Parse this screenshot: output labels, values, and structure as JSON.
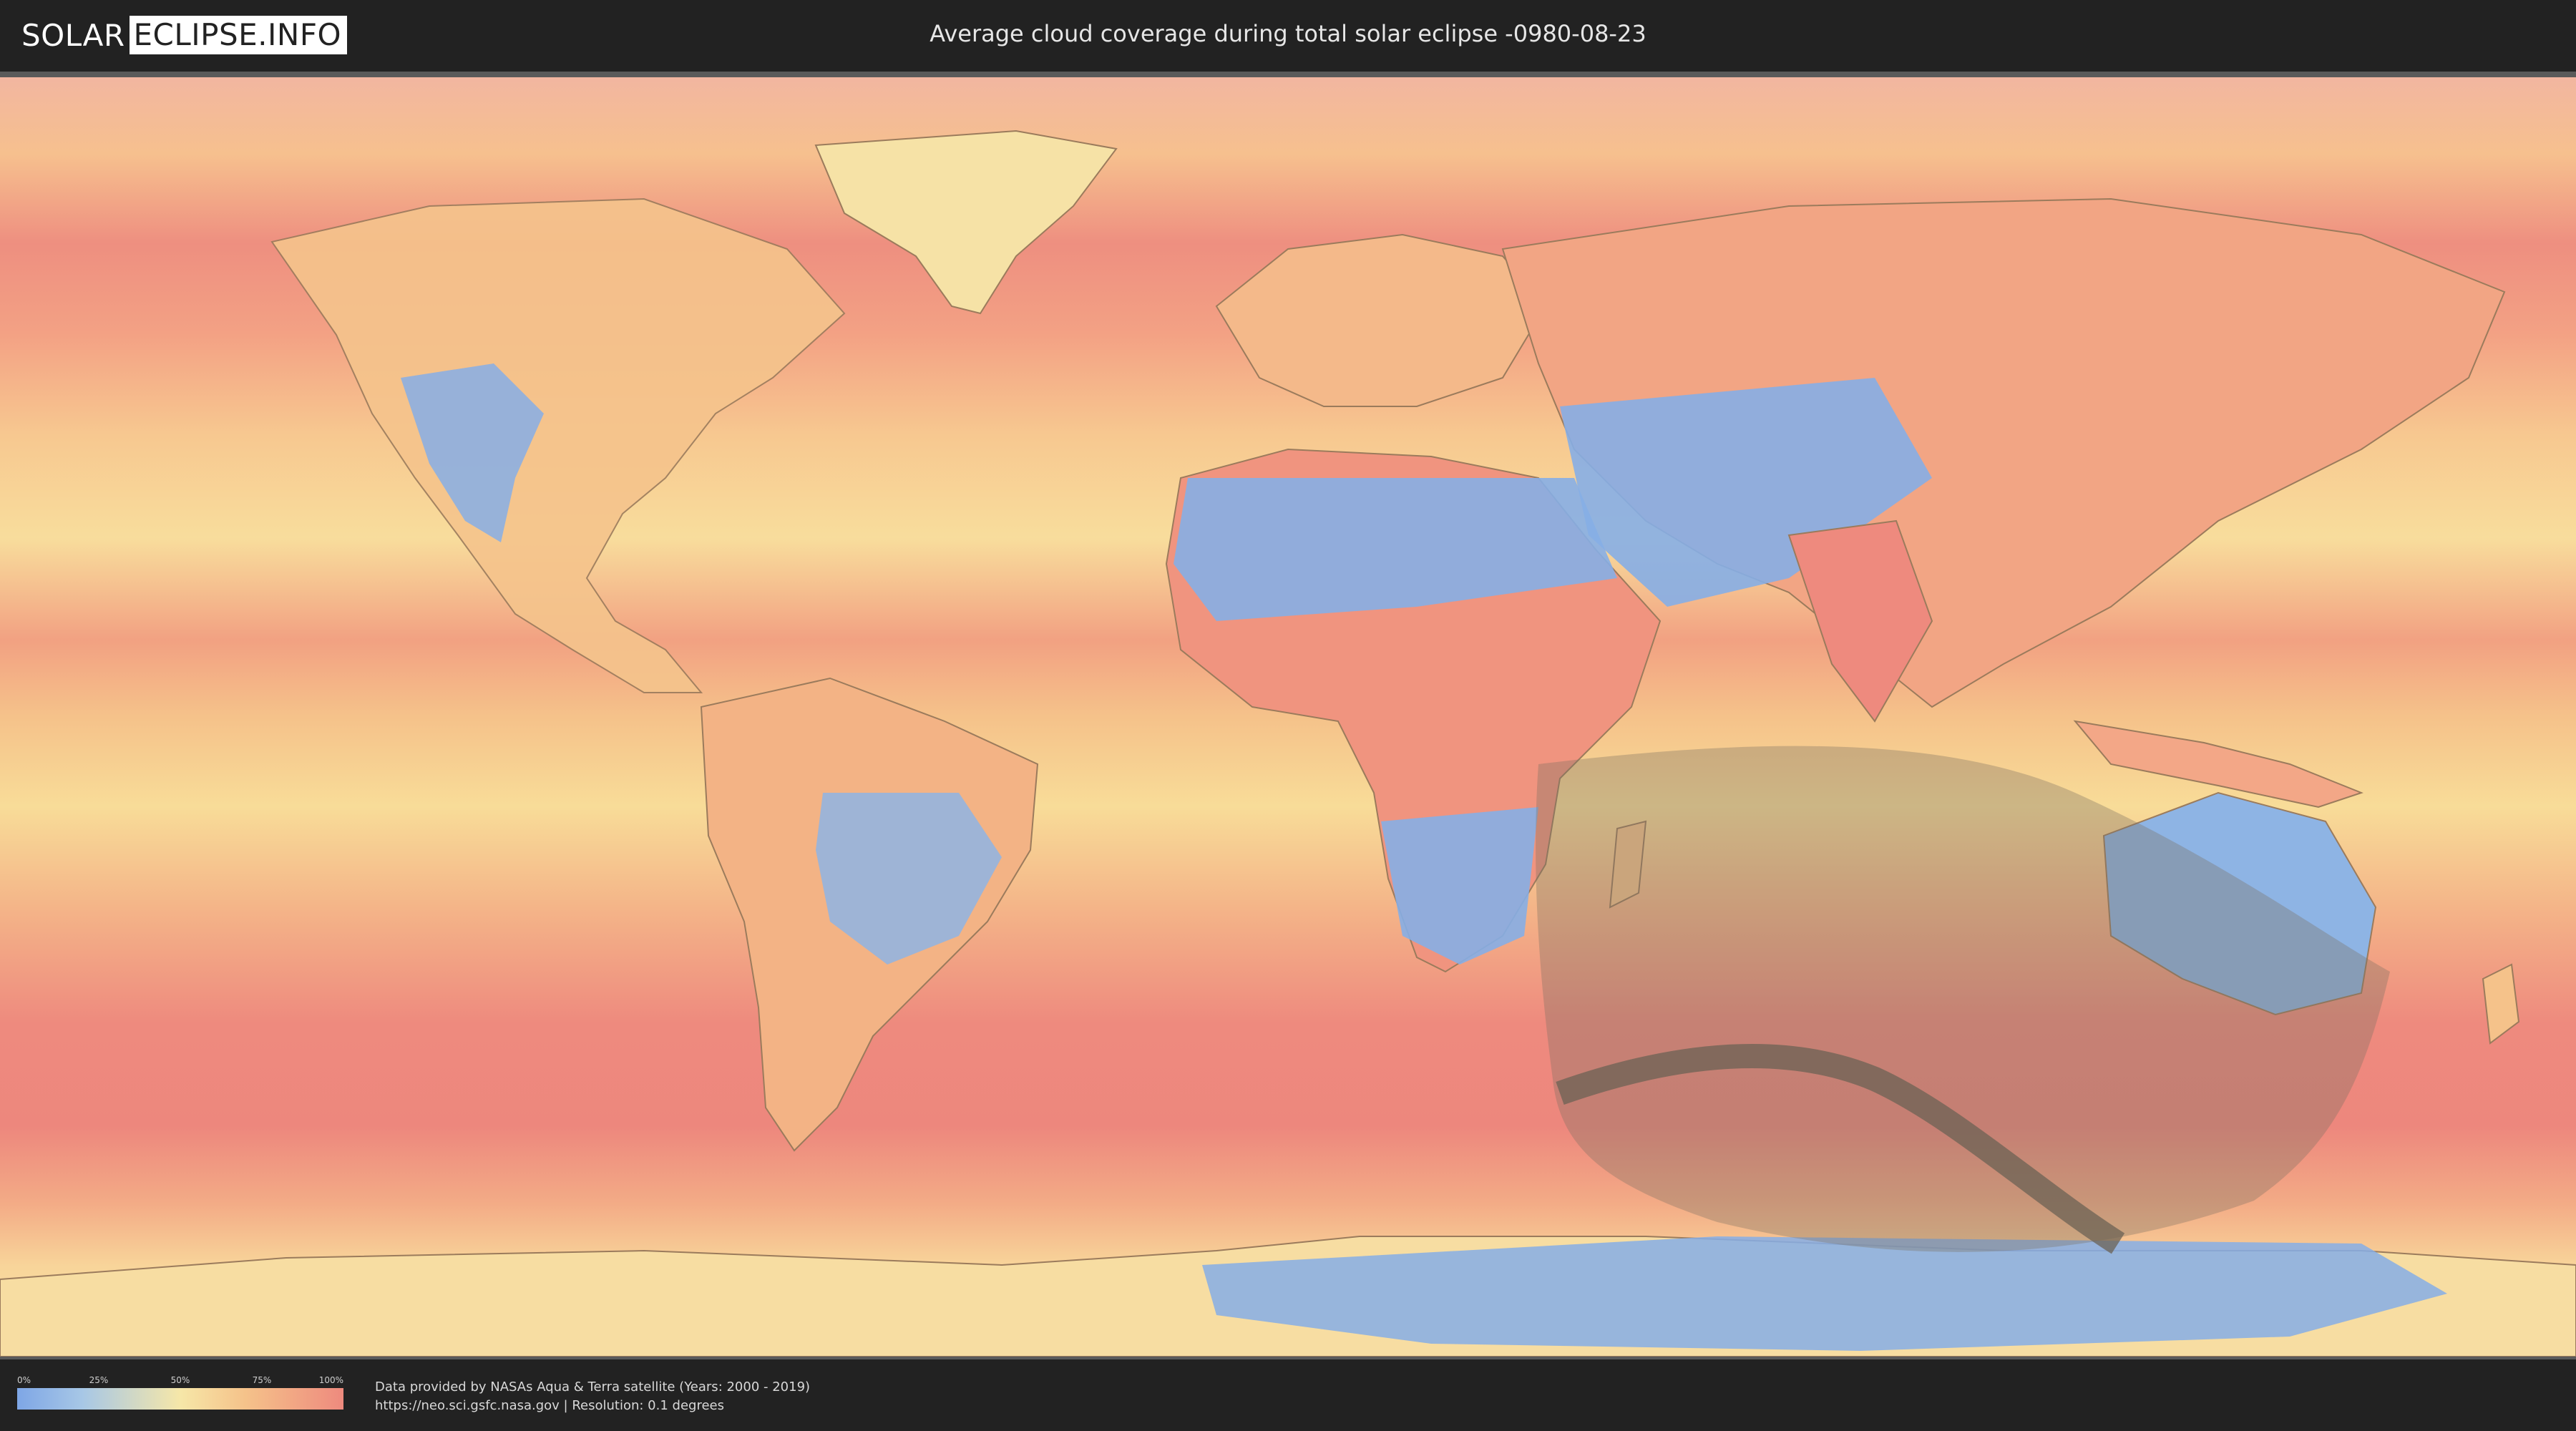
{
  "header": {
    "logo_part1": "SOLAR",
    "logo_part2": "ECLIPSE.INFO",
    "title": "Average cloud coverage during total solar eclipse -0980-08-23"
  },
  "legend": {
    "ticks": [
      "0%",
      "25%",
      "50%",
      "75%",
      "100%"
    ],
    "colors": [
      "#7ea6e6",
      "#a7c7e6",
      "#f6e7a8",
      "#f5c28a",
      "#ee8a7e"
    ]
  },
  "footer": {
    "line1": "Data provided by NASAs Aqua & Terra satellite (Years: 2000 - 2019)",
    "line2": "https://neo.sci.gsfc.nasa.gov | Resolution: 0.1 degrees"
  },
  "map": {
    "colors": {
      "ocean_cloudy": "#ee8a7e",
      "ocean_mid": "#f5c28a",
      "clear_sky": "#86aee6",
      "land_outline": "#9b7b5c",
      "eclipse_shadow": "#7a7060"
    }
  }
}
